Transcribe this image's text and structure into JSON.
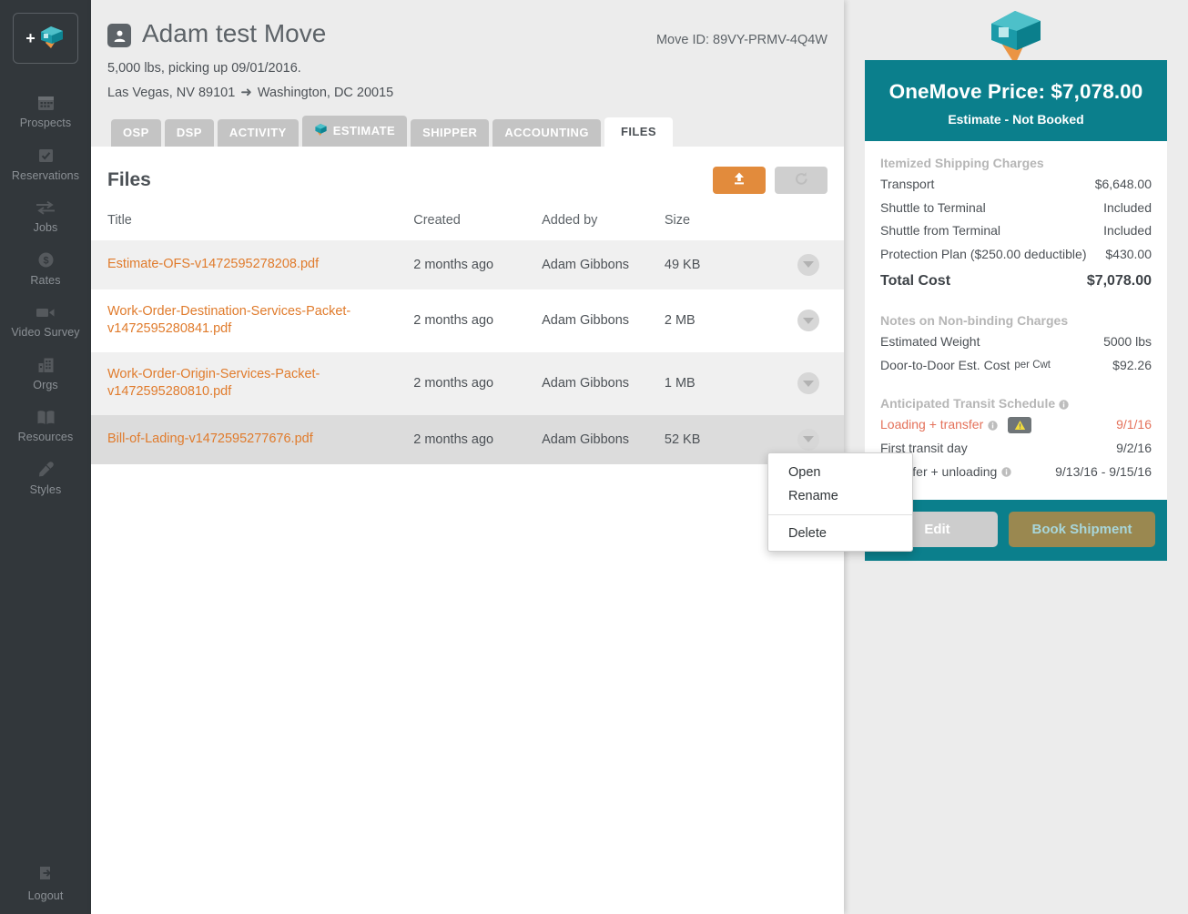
{
  "sidebar": {
    "logo": {
      "name": "onemove-logo",
      "plus": "+"
    },
    "items": [
      {
        "label": "Prospects",
        "icon": "calendar-icon"
      },
      {
        "label": "Reservations",
        "icon": "calendar-check-icon"
      },
      {
        "label": "Jobs",
        "icon": "exchange-arrows-icon"
      },
      {
        "label": "Rates",
        "icon": "dollar-circle-icon"
      },
      {
        "label": "Video Survey",
        "icon": "video-camera-icon"
      },
      {
        "label": "Orgs",
        "icon": "building-icon"
      },
      {
        "label": "Resources",
        "icon": "book-icon"
      },
      {
        "label": "Styles",
        "icon": "eyedropper-icon"
      }
    ],
    "logout": {
      "label": "Logout",
      "icon": "logout-icon"
    }
  },
  "header": {
    "title": "Adam test Move",
    "title_icon": "person-icon",
    "move_id": "Move ID: 89VY-PRMV-4Q4W",
    "summary_line": "5,000 lbs, picking up 09/01/2016.",
    "origin": "Las Vegas, NV 89101",
    "route_arrow": "➜",
    "destination": "Washington, DC 20015"
  },
  "tabs": [
    {
      "label": "OSP",
      "active": false
    },
    {
      "label": "DSP",
      "active": false
    },
    {
      "label": "ACTIVITY",
      "active": false
    },
    {
      "label": "ESTIMATE",
      "active": false,
      "icon": "house-icon"
    },
    {
      "label": "SHIPPER",
      "active": false
    },
    {
      "label": "ACCOUNTING",
      "active": false
    },
    {
      "label": "FILES",
      "active": true
    }
  ],
  "files_panel": {
    "heading": "Files",
    "upload_icon": "upload-icon",
    "refresh_icon": "refresh-icon",
    "columns": [
      "Title",
      "Created",
      "Added by",
      "Size"
    ],
    "rows": [
      {
        "title": "Estimate-OFS-v1472595278208.pdf",
        "created": "2 months ago",
        "added_by": "Adam Gibbons",
        "size": "49 KB"
      },
      {
        "title": "Work-Order-Destination-Services-Packet-v1472595280841.pdf",
        "created": "2 months ago",
        "added_by": "Adam Gibbons",
        "size": "2 MB"
      },
      {
        "title": "Work-Order-Origin-Services-Packet-v1472595280810.pdf",
        "created": "2 months ago",
        "added_by": "Adam Gibbons",
        "size": "1 MB"
      },
      {
        "title": "Bill-of-Lading-v1472595277676.pdf",
        "created": "2 months ago",
        "added_by": "Adam Gibbons",
        "size": "52 KB"
      }
    ]
  },
  "context_menu": {
    "items": [
      "Open",
      "Rename",
      "Delete"
    ]
  },
  "quote": {
    "logo_icon": "house-pin-icon",
    "price_label": "OneMove Price: $7,078.00",
    "status": "Estimate - Not Booked",
    "itemized_heading": "Itemized Shipping Charges",
    "itemized": [
      {
        "label": "Transport",
        "value": "$6,648.00"
      },
      {
        "label": "Shuttle to Terminal",
        "value": "Included"
      },
      {
        "label": "Shuttle from Terminal",
        "value": "Included"
      },
      {
        "label": "Protection Plan ($250.00 deductible)",
        "value": "$430.00"
      }
    ],
    "total_label": "Total Cost",
    "total_value": "$7,078.00",
    "notes_heading": "Notes on Non-binding Charges",
    "notes": [
      {
        "label": "Estimated Weight",
        "value": "5000 lbs"
      },
      {
        "label": "Door-to-Door Est. Cost",
        "unit": "per Cwt",
        "value": "$92.26"
      }
    ],
    "transit_heading": "Anticipated Transit Schedule",
    "transit": [
      {
        "label": "Loading + transfer",
        "value": "9/1/16",
        "warn": true,
        "info": true,
        "badge": "warning-triangle-icon"
      },
      {
        "label": "First transit day",
        "value": "9/2/16",
        "warn": false,
        "info": false
      },
      {
        "label": "Transfer + unloading",
        "value": "9/13/16 - 9/15/16",
        "warn": false,
        "info": true
      }
    ],
    "edit_label": "Edit",
    "book_label": "Book Shipment"
  },
  "colors": {
    "sidebar": "#32373b",
    "teal": "#0b7f8c",
    "orange": "#e28b3c",
    "link_orange": "#e07b2c",
    "gold": "#9a8850",
    "warn_red": "#e4715a"
  }
}
